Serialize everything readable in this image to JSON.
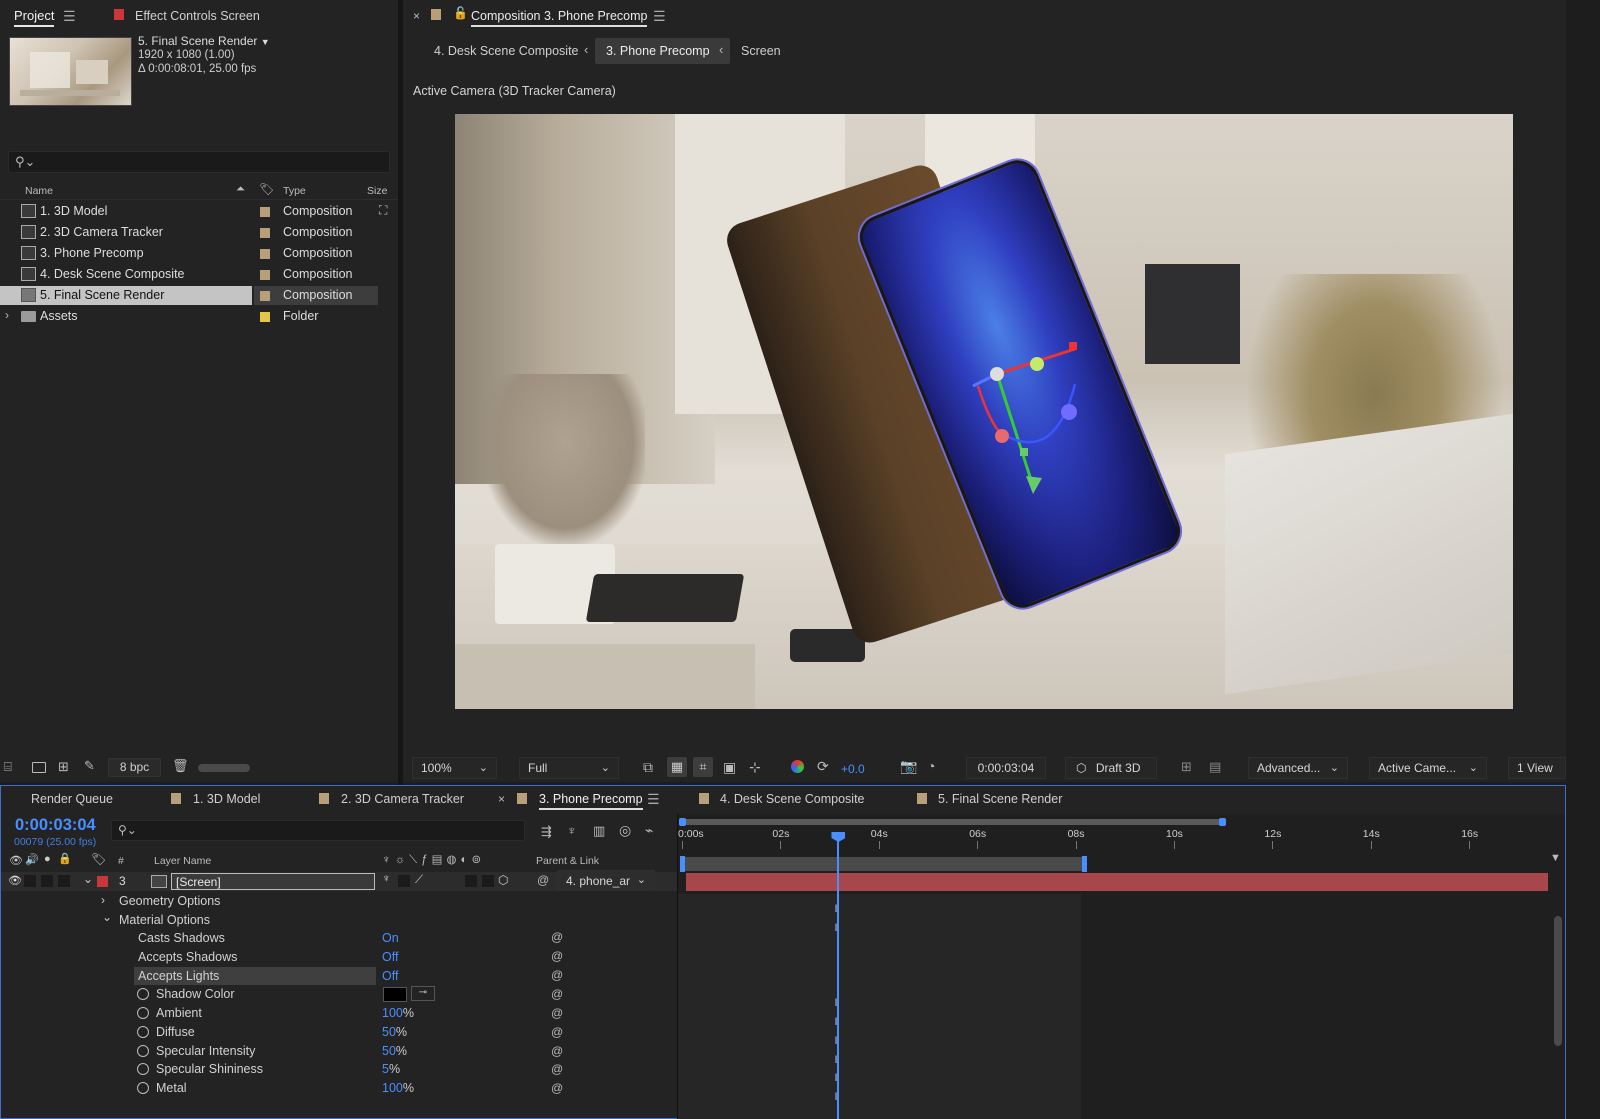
{
  "project_panel": {
    "tab_project": "Project",
    "tab_effect_controls": "Effect Controls Screen",
    "preview": {
      "title": "5. Final Scene Render",
      "dims": "1920 x 1080 (1.00)",
      "duration": "Δ 0:00:08:01, 25.00 fps"
    },
    "columns": {
      "name": "Name",
      "type": "Type",
      "size": "Size"
    },
    "items": [
      {
        "name": "1. 3D Model",
        "type": "Composition"
      },
      {
        "name": "2. 3D Camera Tracker",
        "type": "Composition"
      },
      {
        "name": "3. Phone Precomp",
        "type": "Composition"
      },
      {
        "name": "4. Desk Scene Composite",
        "type": "Composition"
      },
      {
        "name": "5. Final Scene Render",
        "type": "Composition",
        "selected": true
      },
      {
        "name": "Assets",
        "type": "Folder"
      }
    ],
    "bpc": "8 bpc"
  },
  "comp_panel": {
    "title": "Composition 3. Phone Precomp",
    "breadcrumbs": [
      "4. Desk Scene Composite",
      "3. Phone Precomp",
      "Screen"
    ],
    "camera_label": "Active Camera (3D Tracker Camera)",
    "footer": {
      "zoom": "100%",
      "resolution": "Full",
      "exposure": "+0.0",
      "timecode": "0:00:03:04",
      "draft3d": "Draft 3D",
      "renderer": "Advanced...",
      "camera": "Active Came...",
      "views": "1 View"
    }
  },
  "timeline": {
    "tabs": [
      "Render Queue",
      "1. 3D Model",
      "2. 3D Camera Tracker",
      "3. Phone Precomp",
      "4. Desk Scene Composite",
      "5. Final Scene Render"
    ],
    "active_tab_index": 3,
    "timecode": "0:00:03:04",
    "frame_info": "00079 (25.00 fps)",
    "col_hash": "#",
    "col_layer_name": "Layer Name",
    "col_parent": "Parent & Link",
    "layer": {
      "num": "3",
      "name": "[Screen]",
      "parent": "4. phone_ar"
    },
    "ruler_labels": [
      "0:00s",
      "02s",
      "04s",
      "06s",
      "08s",
      "10s",
      "12s",
      "14s",
      "16s"
    ],
    "playhead_seconds": 3.16,
    "groups": [
      "Geometry Options",
      "Material Options"
    ],
    "properties": [
      {
        "label": "Casts Shadows",
        "value": "On",
        "unit": ""
      },
      {
        "label": "Accepts Shadows",
        "value": "Off",
        "unit": ""
      },
      {
        "label": "Accepts Lights",
        "value": "Off",
        "unit": ""
      },
      {
        "label": "Shadow Color",
        "value": "",
        "unit": ""
      },
      {
        "label": "Ambient",
        "value": "100",
        "unit": "%"
      },
      {
        "label": "Diffuse",
        "value": "50",
        "unit": "%"
      },
      {
        "label": "Specular Intensity",
        "value": "50",
        "unit": "%"
      },
      {
        "label": "Specular Shininess",
        "value": "5",
        "unit": "%"
      },
      {
        "label": "Metal",
        "value": "100",
        "unit": "%"
      }
    ]
  },
  "colors": {
    "accent_blue": "#4a8fff",
    "label_red": "#c8373a",
    "comp_tan": "#b7a079",
    "folder_yellow": "#e2c74a",
    "layer_bar": "#a8474b"
  }
}
